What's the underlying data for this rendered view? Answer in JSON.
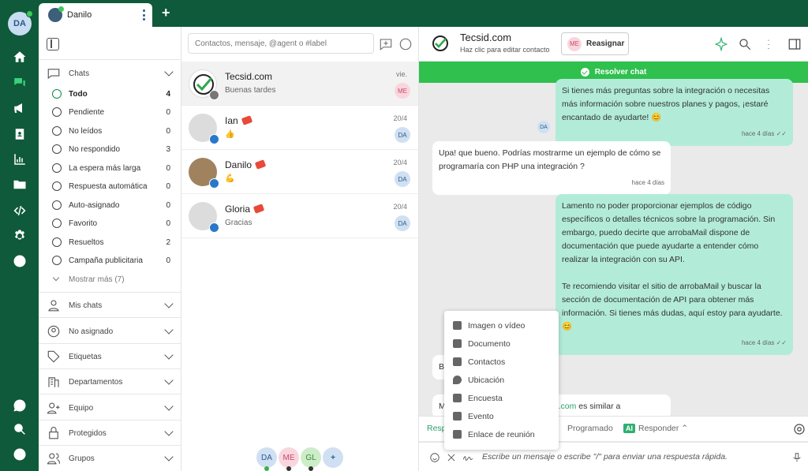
{
  "colors": {
    "brand": "#0e5a3a",
    "accent": "#2fc04e",
    "outgoing_bubble": "#b2ecd8"
  },
  "user": {
    "initials": "DA"
  },
  "rail_icons": [
    "home-icon",
    "chats-icon",
    "megaphone-icon",
    "contacts-icon",
    "reports-icon",
    "folder-icon",
    "code-icon",
    "settings-icon",
    "help-icon",
    "whatsapp-icon",
    "search-icon",
    "add-icon"
  ],
  "tab": {
    "name": "Danilo",
    "add": "+"
  },
  "sidebar": {
    "chats_label": "Chats",
    "items": [
      {
        "label": "Todo",
        "count": "4"
      },
      {
        "label": "Pendiente",
        "count": "0"
      },
      {
        "label": "No leídos",
        "count": "0"
      },
      {
        "label": "No respondido",
        "count": "3"
      },
      {
        "label": "La espera más larga",
        "count": "0"
      },
      {
        "label": "Respuesta automática",
        "count": "0"
      },
      {
        "label": "Auto-asignado",
        "count": "0"
      },
      {
        "label": "Favorito",
        "count": "0"
      },
      {
        "label": "Resueltos",
        "count": "2"
      },
      {
        "label": "Campaña publicitaria",
        "count": "0"
      }
    ],
    "more": "Mostrar más (7)",
    "sections": [
      "Mis chats",
      "No asignado",
      "Etiquetas",
      "Departamentos",
      "Equipo",
      "Protegidos",
      "Grupos"
    ]
  },
  "search": {
    "placeholder": "Contactos, mensaje, @agent o #label"
  },
  "conversations": [
    {
      "name": "Tecsid.com",
      "preview": "Buenas tardes",
      "time": "vie.",
      "agent": "ME"
    },
    {
      "name": "Ian",
      "preview": "👍",
      "time": "20/4",
      "agent": "DA"
    },
    {
      "name": "Danilo",
      "preview": "💪",
      "time": "20/4",
      "agent": "DA"
    },
    {
      "name": "Gloria",
      "preview": "Gracias",
      "time": "20/4",
      "agent": "DA"
    }
  ],
  "agents": [
    "DA",
    "ME",
    "GL",
    "+"
  ],
  "chat": {
    "title": "Tecsid.com",
    "subtitle": "Haz clic para editar contacto",
    "reassign_initials": "ME",
    "reassign": "Reasignar",
    "resolve": "Resolver chat",
    "messages": [
      {
        "dir": "out",
        "text": "Si tienes más preguntas sobre la integración o necesitas más información sobre nuestros planes y pagos, ¡estaré encantado de ayudarte! 😊",
        "time": "hace 4 días"
      },
      {
        "dir": "in",
        "text": "Upa! que bueno. Podrías mostrarme un ejemplo de cómo se programaría con PHP una integración ?",
        "time": "hace 4 días"
      },
      {
        "dir": "out",
        "text": "Lamento no poder proporcionar ejemplos de código específicos o detalles técnicos sobre la programación. Sin embargo, puedo decirte que arrobaMail dispone de documentación que puede ayudarte a entender cómo realizar la integración con su API.",
        "text2": "Te recomiendo visitar el sitio de arrobaMail y buscar la sección de documentación de API para obtener más información. Si tienes más dudas, aquí estoy para ayudarte. 😊",
        "time": "hace 4 días"
      },
      {
        "dir": "in",
        "text": "B"
      },
      {
        "dir": "in",
        "text": "M",
        "text_tail_link": "e.com",
        "text_tail": " es similar a"
      }
    ],
    "avatar_initials": "DA"
  },
  "attach_menu": [
    "Imagen o vídeo",
    "Documento",
    "Contactos",
    "Ubicación",
    "Encuesta",
    "Evento",
    "Enlace de reunión"
  ],
  "composer": {
    "tabs": [
      "Respo",
      "Programado",
      "Responder"
    ],
    "ai_badge": "AI",
    "placeholder": "Escribe un mensaje o escribe \"/\" para enviar una respuesta rápida."
  }
}
